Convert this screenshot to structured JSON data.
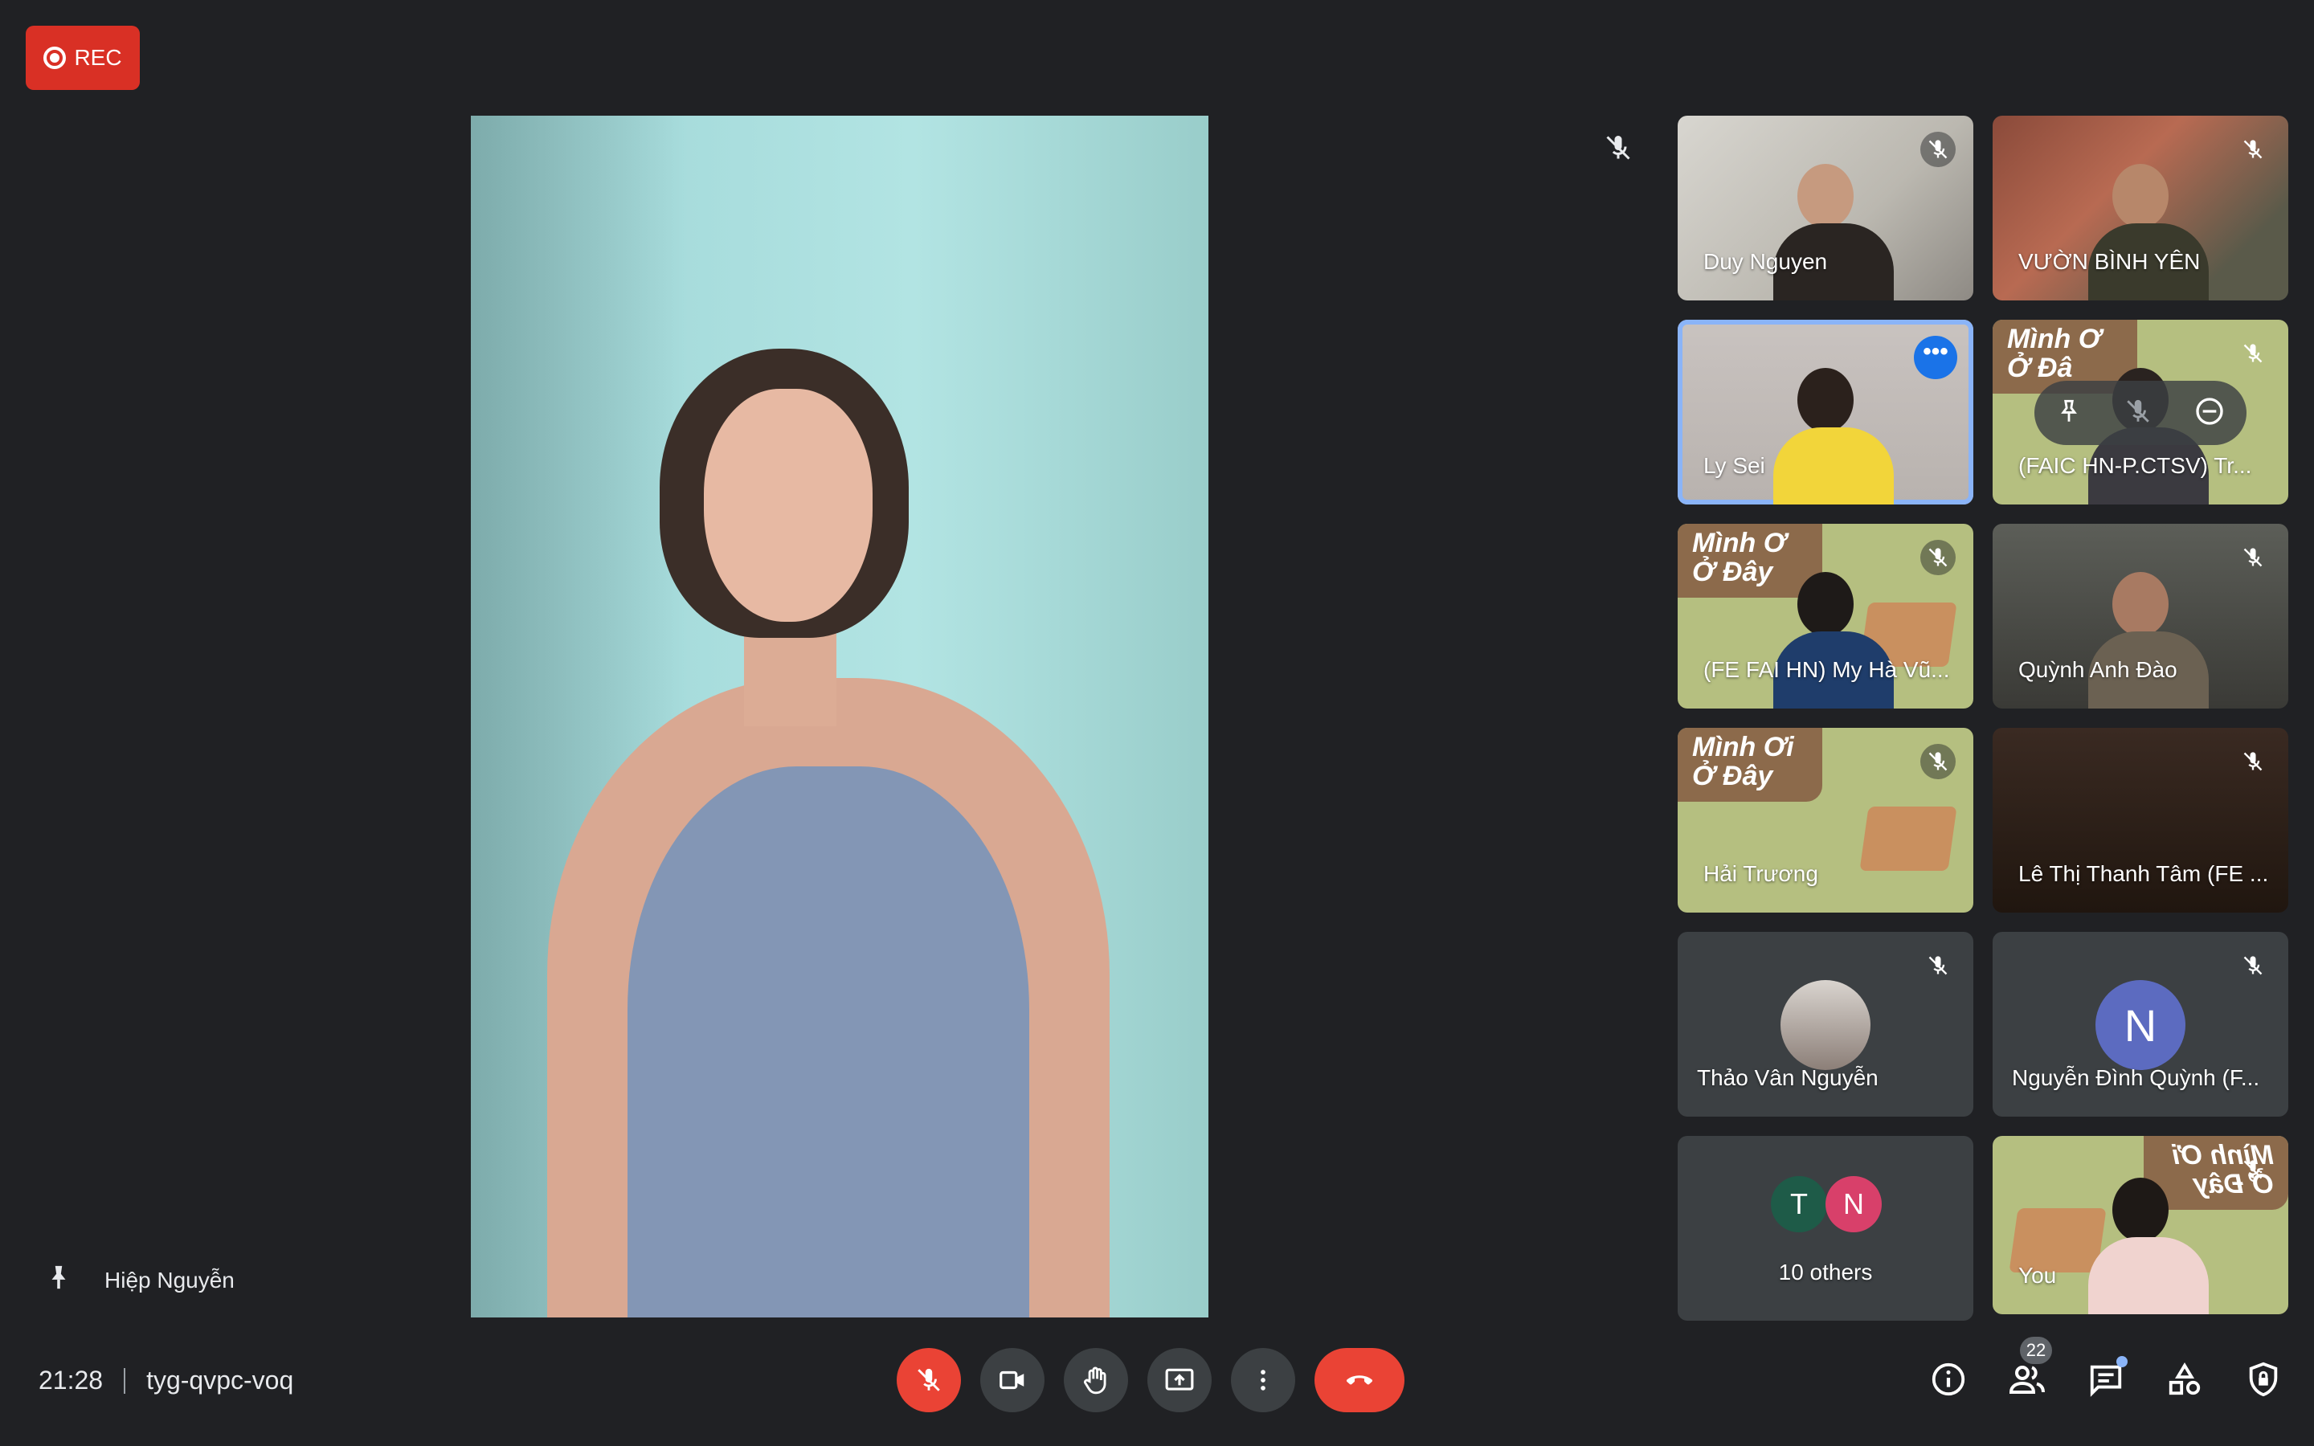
{
  "recording": {
    "label": "REC"
  },
  "pinned": {
    "name": "Hiệp Nguyễn"
  },
  "meeting": {
    "time": "21:28",
    "code": "tyg-qvpc-voq"
  },
  "tiles": [
    {
      "name": "Duy Nguyen"
    },
    {
      "name": "VƯỜN BÌNH YÊN"
    },
    {
      "name": "Ly Sei"
    },
    {
      "name": "(FAIC HN-P.CTSV) Tr...",
      "banner": "Mình Ơ\nỞ Đâ"
    },
    {
      "name": "(FE FAI HN) My Hà Vũ...",
      "banner": "Mình Ơ\nỞ Đây"
    },
    {
      "name": "Quỳnh Anh Đào"
    },
    {
      "name": "Hải Trương",
      "banner": "Mình Ơi\nỞ Đây"
    },
    {
      "name": "Lê Thị Thanh Tâm (FE ..."
    },
    {
      "name": "Thảo Vân Nguyễn"
    },
    {
      "name": "Nguyễn Đình Quỳnh (F...",
      "initial": "N"
    },
    {
      "name": "10 others",
      "initial_a": "T",
      "initial_b": "N"
    },
    {
      "name": "You",
      "banner": "Mình Ơi\nỞ Đây"
    }
  ],
  "people_count": "22",
  "colors": {
    "accent": "#8ab4f8",
    "rec": "#d93025",
    "end_call": "#ea4335",
    "avatar_n": "#5c6bc0",
    "avatar_t": "#1e5b48",
    "avatar_n2": "#d8406a"
  }
}
